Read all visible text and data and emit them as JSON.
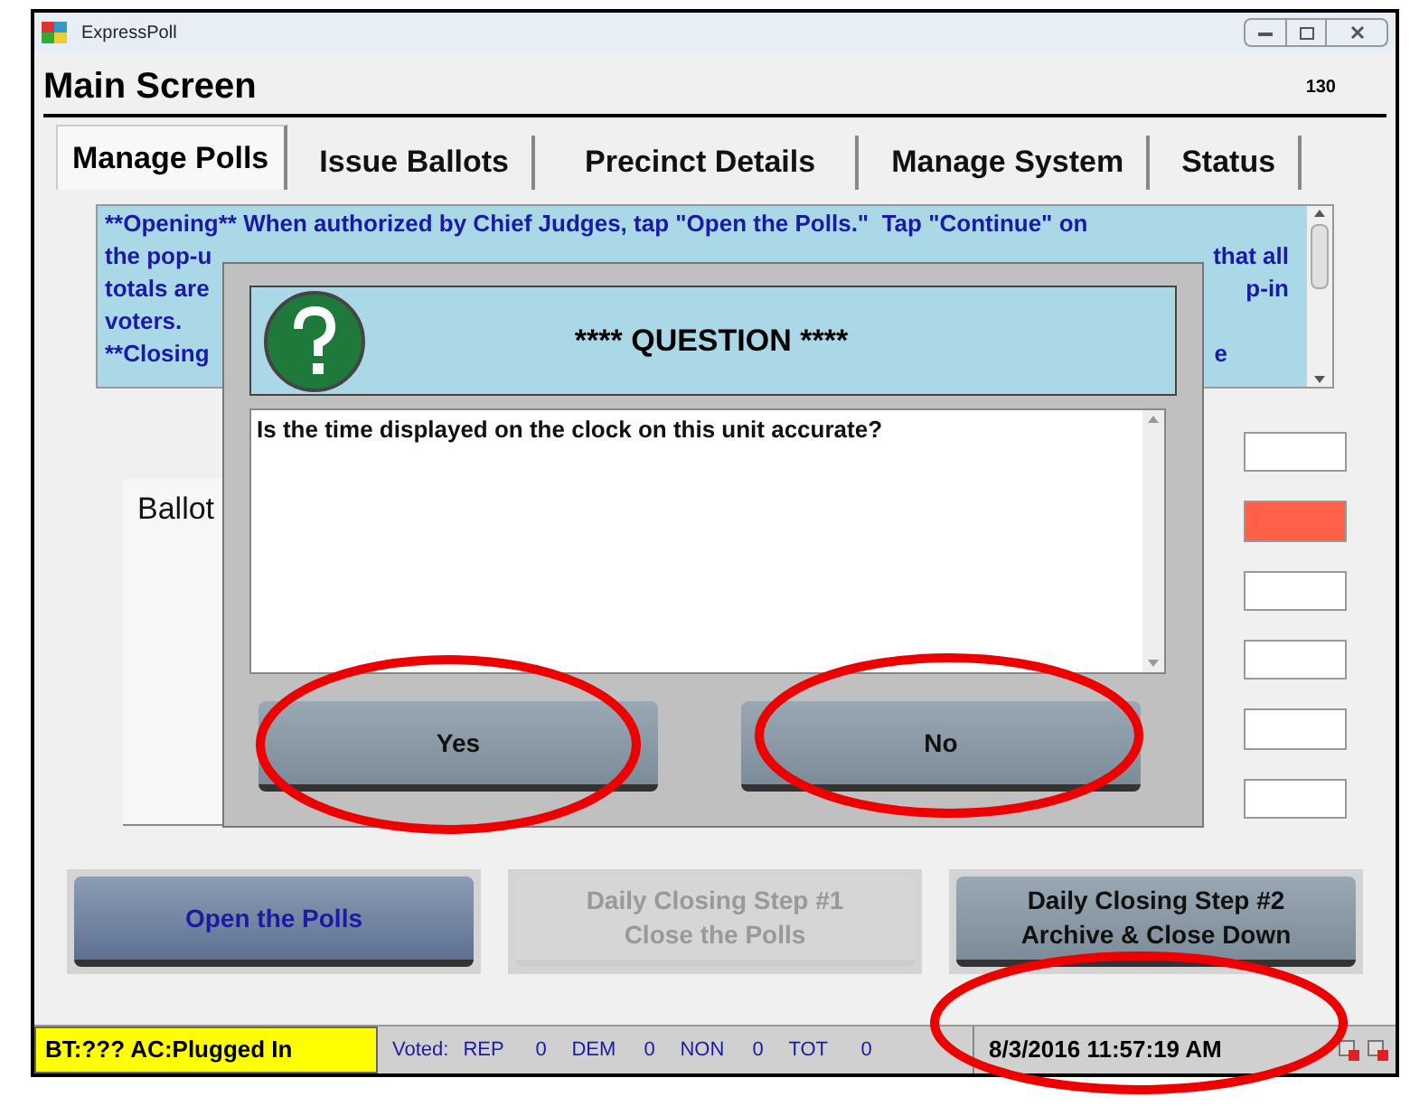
{
  "window": {
    "title": "ExpressPoll"
  },
  "header": {
    "title": "Main Screen",
    "number": "130"
  },
  "tabs": [
    {
      "label": "Manage Polls",
      "selected": true
    },
    {
      "label": "Issue Ballots",
      "selected": false
    },
    {
      "label": "Precinct Details",
      "selected": false
    },
    {
      "label": "Manage System",
      "selected": false
    },
    {
      "label": "Status",
      "selected": false
    }
  ],
  "instructions": {
    "lines": [
      {
        "left": "**Opening** When authorized by Chief Judges, tap \"Open the Polls.\"  Tap \"Continue\" on"
      },
      {
        "left": "the pop-u",
        "right": "that all"
      },
      {
        "left": "totals are",
        "right": "p-in"
      },
      {
        "left": "voters."
      },
      {
        "left": "**Closing",
        "right": "e"
      }
    ]
  },
  "ballot_panel": {
    "label": "Ballot"
  },
  "fields": [
    {
      "alert": false
    },
    {
      "alert": true
    },
    {
      "alert": false
    },
    {
      "alert": false
    },
    {
      "alert": false
    },
    {
      "alert": false
    }
  ],
  "dialog": {
    "title": "**** QUESTION ****",
    "message": "Is the time displayed on the clock on this unit accurate?",
    "buttons": [
      "Yes",
      "No"
    ]
  },
  "actions": [
    {
      "lines": [
        "Open the Polls"
      ],
      "disabled": false,
      "kind": "open"
    },
    {
      "lines": [
        "Daily Closing Step #1",
        "Close the Polls"
      ],
      "disabled": true,
      "kind": "close"
    },
    {
      "lines": [
        "Daily Closing Step #2",
        "Archive & Close Down"
      ],
      "disabled": false,
      "kind": "archive"
    }
  ],
  "status_bar": {
    "power": "BT:??? AC:Plugged In",
    "voted_label": "Voted:",
    "counts": [
      {
        "party": "REP",
        "count": "0"
      },
      {
        "party": "DEM",
        "count": "0"
      },
      {
        "party": "NON",
        "count": "0"
      },
      {
        "party": "TOT",
        "count": "0"
      }
    ],
    "datetime": "8/3/2016 11:57:19 AM"
  }
}
